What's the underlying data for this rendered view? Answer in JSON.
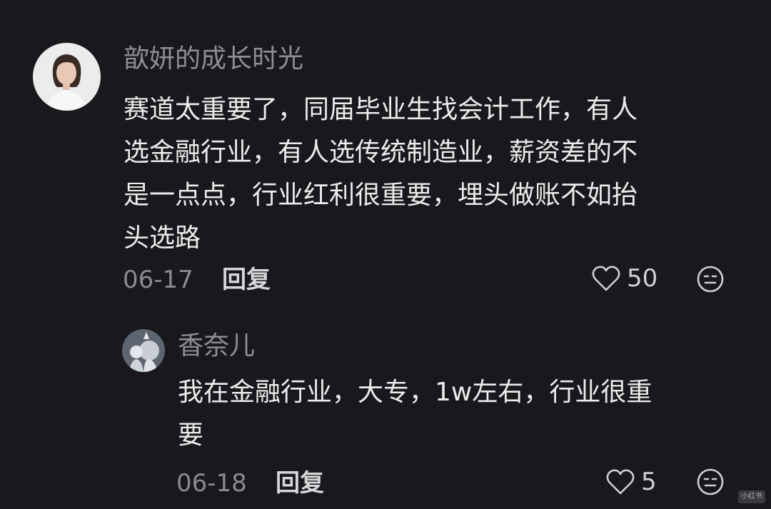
{
  "comment": {
    "username": "歆妍的成长时光",
    "text_lines": [
      "赛道太重要了，同届毕业生找会计工作，有人",
      "选金融行业，有人选传统制造业，薪资差的不",
      "是一点点，行业红利很重要，埋头做账不如抬",
      "头选路"
    ],
    "date": "06-17",
    "reply_label": "回复",
    "likes": "50"
  },
  "reply": {
    "username": "香奈儿",
    "text_lines": [
      "我在金融行业，大专，1w左右，行业很重",
      "要"
    ],
    "date": "06-18",
    "reply_label": "回复",
    "likes": "5"
  },
  "watermark": "小红书",
  "colors": {
    "background": "#19181d",
    "username": "#8f8e94",
    "text": "#ececec",
    "date": "#8a8a8f"
  }
}
